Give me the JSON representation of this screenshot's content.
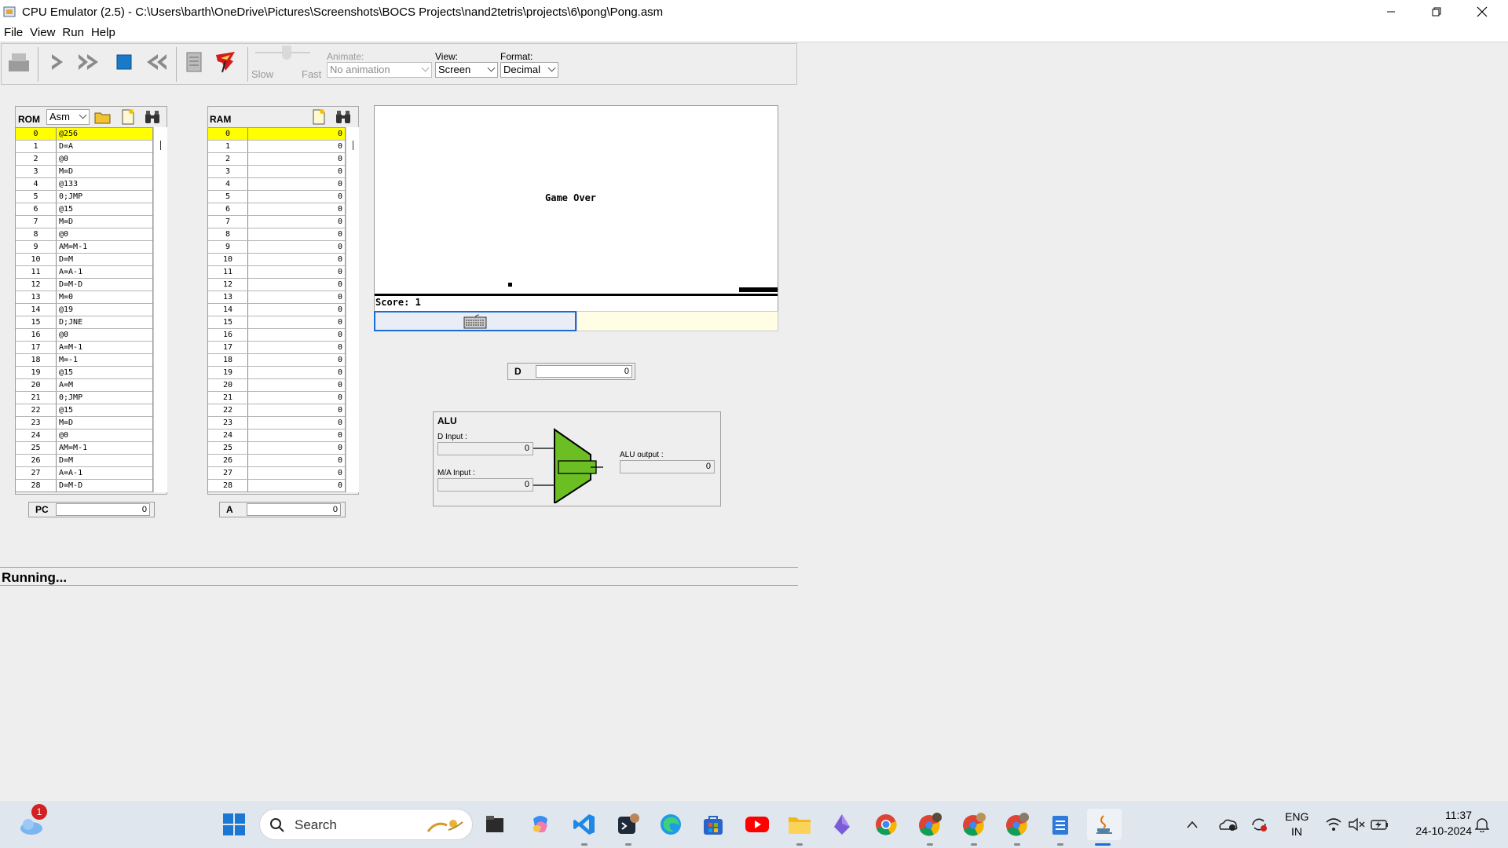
{
  "window": {
    "title": "CPU Emulator (2.5) - C:\\Users\\barth\\OneDrive\\Pictures\\Screenshots\\BOCS Projects\\nand2tetris\\projects\\6\\pong\\Pong.asm"
  },
  "menu": [
    "File",
    "View",
    "Run",
    "Help"
  ],
  "toolbar": {
    "slow": "Slow",
    "fast": "Fast",
    "animate_label": "Animate:",
    "animate_value": "No animation",
    "view_label": "View:",
    "view_value": "Screen",
    "format_label": "Format:",
    "format_value": "Decimal",
    "icons": [
      "load-program-icon",
      "single-step-icon",
      "run-icon",
      "stop-icon",
      "rewind-icon",
      "script-icon",
      "breakpoints-icon"
    ]
  },
  "rom": {
    "label": "ROM",
    "format": "Asm",
    "rows": [
      [
        "0",
        "@256"
      ],
      [
        "1",
        "D=A"
      ],
      [
        "2",
        "@0"
      ],
      [
        "3",
        "M=D"
      ],
      [
        "4",
        "@133"
      ],
      [
        "5",
        "0;JMP"
      ],
      [
        "6",
        "@15"
      ],
      [
        "7",
        "M=D"
      ],
      [
        "8",
        "@0"
      ],
      [
        "9",
        "AM=M-1"
      ],
      [
        "10",
        "D=M"
      ],
      [
        "11",
        "A=A-1"
      ],
      [
        "12",
        "D=M-D"
      ],
      [
        "13",
        "M=0"
      ],
      [
        "14",
        "@19"
      ],
      [
        "15",
        "D;JNE"
      ],
      [
        "16",
        "@0"
      ],
      [
        "17",
        "A=M-1"
      ],
      [
        "18",
        "M=-1"
      ],
      [
        "19",
        "@15"
      ],
      [
        "20",
        "A=M"
      ],
      [
        "21",
        "0;JMP"
      ],
      [
        "22",
        "@15"
      ],
      [
        "23",
        "M=D"
      ],
      [
        "24",
        "@0"
      ],
      [
        "25",
        "AM=M-1"
      ],
      [
        "26",
        "D=M"
      ],
      [
        "27",
        "A=A-1"
      ],
      [
        "28",
        "D=M-D"
      ]
    ]
  },
  "ram": {
    "label": "RAM",
    "rows": [
      [
        "0",
        "0"
      ],
      [
        "1",
        "0"
      ],
      [
        "2",
        "0"
      ],
      [
        "3",
        "0"
      ],
      [
        "4",
        "0"
      ],
      [
        "5",
        "0"
      ],
      [
        "6",
        "0"
      ],
      [
        "7",
        "0"
      ],
      [
        "8",
        "0"
      ],
      [
        "9",
        "0"
      ],
      [
        "10",
        "0"
      ],
      [
        "11",
        "0"
      ],
      [
        "12",
        "0"
      ],
      [
        "13",
        "0"
      ],
      [
        "14",
        "0"
      ],
      [
        "15",
        "0"
      ],
      [
        "16",
        "0"
      ],
      [
        "17",
        "0"
      ],
      [
        "18",
        "0"
      ],
      [
        "19",
        "0"
      ],
      [
        "20",
        "0"
      ],
      [
        "21",
        "0"
      ],
      [
        "22",
        "0"
      ],
      [
        "23",
        "0"
      ],
      [
        "24",
        "0"
      ],
      [
        "25",
        "0"
      ],
      [
        "26",
        "0"
      ],
      [
        "27",
        "0"
      ],
      [
        "28",
        "0"
      ]
    ]
  },
  "registers": {
    "pc_label": "PC",
    "pc_value": "0",
    "a_label": "A",
    "a_value": "0",
    "d_label": "D",
    "d_value": "0"
  },
  "screen": {
    "game_over": "Game Over",
    "score": "Score: 1"
  },
  "alu": {
    "title": "ALU",
    "d_input_label": "D Input :",
    "d_input_value": "0",
    "ma_input_label": "M/A Input :",
    "ma_input_value": "0",
    "output_label": "ALU output :",
    "output_value": "0",
    "color": "#6cbf23"
  },
  "status": "Running...",
  "taskbar": {
    "search_placeholder": "Search",
    "weather_badge": "1",
    "lang_line1": "ENG",
    "lang_line2": "IN",
    "time": "11:37",
    "date": "24-10-2024",
    "icons": [
      "weather-icon",
      "windows-start-icon",
      "search-icon",
      "file-explorer-dark-icon",
      "copilot-icon",
      "vscode-icon",
      "terminal-icon",
      "edge-icon",
      "store-icon",
      "youtube-icon",
      "folder-icon",
      "app-icon",
      "chrome-icon",
      "chrome-profile-1-icon",
      "chrome-profile-2-icon",
      "chrome-profile-3-icon",
      "notepad-icon",
      "java-icon"
    ]
  }
}
